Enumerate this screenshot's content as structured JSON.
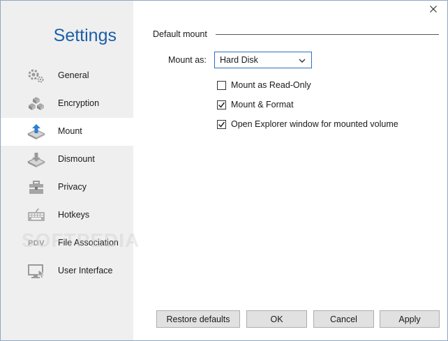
{
  "window": {
    "title": "Settings",
    "close_label": "✕"
  },
  "sidebar": {
    "items": [
      {
        "label": "General",
        "icon": "gear-icon",
        "active": false
      },
      {
        "label": "Encryption",
        "icon": "cubes-icon",
        "active": false
      },
      {
        "label": "Mount",
        "icon": "mount-icon",
        "active": true
      },
      {
        "label": "Dismount",
        "icon": "dismount-icon",
        "active": false
      },
      {
        "label": "Privacy",
        "icon": "toolbox-icon",
        "active": false
      },
      {
        "label": "Hotkeys",
        "icon": "keyboard-icon",
        "active": false
      },
      {
        "label": "File Association",
        "icon": "pdv-file-icon",
        "active": false
      },
      {
        "label": "User Interface",
        "icon": "monitor-cursor-icon",
        "active": false
      }
    ],
    "file_association_prefix": "PDV"
  },
  "main": {
    "group_title": "Default mount",
    "mount_as_label": "Mount as:",
    "mount_as_value": "Hard Disk",
    "options": [
      {
        "label": "Mount as Read-Only",
        "checked": false
      },
      {
        "label": "Mount & Format",
        "checked": true
      },
      {
        "label": "Open Explorer window for mounted volume",
        "checked": true
      }
    ]
  },
  "buttons": {
    "restore": "Restore defaults",
    "ok": "OK",
    "cancel": "Cancel",
    "apply": "Apply"
  },
  "watermark": "SOFTPEDIA",
  "colors": {
    "accent": "#1b5fa8",
    "sidebar_bg": "#efefef",
    "icon_gray": "#9a9a9a",
    "mount_icon_blue": "#2b7fd4"
  }
}
